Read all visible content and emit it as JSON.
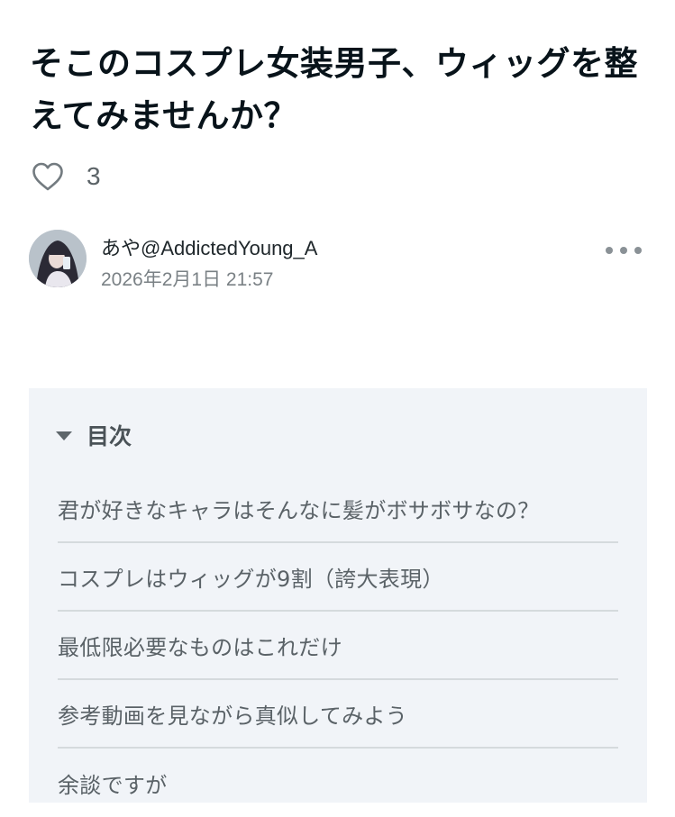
{
  "article": {
    "title": "そこのコスプレ女装男子、ウィッグを整えてみませんか？",
    "like_count": "3"
  },
  "author": {
    "name": "あや@AddictedYoung_A",
    "date": "2026年2月1日 21:57"
  },
  "icons": {
    "like": "heart-outline-icon",
    "more": "ellipsis-horizontal-icon",
    "toc_toggle": "caret-down-icon"
  },
  "toc": {
    "title": "目次",
    "items": [
      "君が好きなキャラはそんなに髪がボサボサなの？",
      "コスプレはウィッグが9割（誇大表現）",
      "最低限必要なものはこれだけ",
      "参考動画を見ながら真似してみよう",
      "余談ですが"
    ]
  },
  "colors": {
    "title_text": "#08131a",
    "toc_background": "#f1f4f8",
    "toc_divider": "#d5dadd",
    "muted_text": "#5a6267"
  }
}
